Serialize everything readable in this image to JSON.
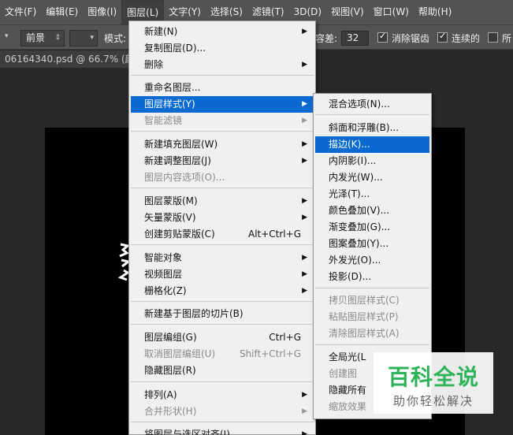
{
  "menubar": {
    "items": [
      "文件(F)",
      "编辑(E)",
      "图像(I)",
      "图层(L)",
      "文字(Y)",
      "选择(S)",
      "滤镜(T)",
      "3D(D)",
      "视图(V)",
      "窗口(W)",
      "帮助(H)"
    ]
  },
  "options": {
    "fill_source": "前景",
    "mode_label": "模式:",
    "tolerance_label": "容差:",
    "tolerance_value": "32",
    "antialias_label": "消除锯齿",
    "contiguous_label": "连续的",
    "all_layers_label": "所"
  },
  "document": {
    "tab_title": "06164340.psd @ 66.7% (颜色"
  },
  "layer_menu": {
    "items": [
      {
        "label": "新建(N)",
        "shortcut": "",
        "submenu": true,
        "disabled": false
      },
      {
        "label": "复制图层(D)...",
        "shortcut": "",
        "submenu": false,
        "disabled": false
      },
      {
        "label": "删除",
        "shortcut": "",
        "submenu": true,
        "disabled": false
      },
      {
        "label": "重命名图层...",
        "shortcut": "",
        "submenu": false,
        "disabled": false
      },
      {
        "label": "图层样式(Y)",
        "shortcut": "",
        "submenu": true,
        "disabled": false
      },
      {
        "label": "智能滤镜",
        "shortcut": "",
        "submenu": true,
        "disabled": true
      },
      {
        "label": "新建填充图层(W)",
        "shortcut": "",
        "submenu": true,
        "disabled": false
      },
      {
        "label": "新建调整图层(J)",
        "shortcut": "",
        "submenu": true,
        "disabled": false
      },
      {
        "label": "图层内容选项(O)...",
        "shortcut": "",
        "submenu": false,
        "disabled": true
      },
      {
        "label": "图层蒙版(M)",
        "shortcut": "",
        "submenu": true,
        "disabled": false
      },
      {
        "label": "矢量蒙版(V)",
        "shortcut": "",
        "submenu": true,
        "disabled": false
      },
      {
        "label": "创建剪贴蒙版(C)",
        "shortcut": "Alt+Ctrl+G",
        "submenu": false,
        "disabled": false
      },
      {
        "label": "智能对象",
        "shortcut": "",
        "submenu": true,
        "disabled": false
      },
      {
        "label": "视频图层",
        "shortcut": "",
        "submenu": true,
        "disabled": false
      },
      {
        "label": "栅格化(Z)",
        "shortcut": "",
        "submenu": true,
        "disabled": false
      },
      {
        "label": "新建基于图层的切片(B)",
        "shortcut": "",
        "submenu": false,
        "disabled": false
      },
      {
        "label": "图层编组(G)",
        "shortcut": "Ctrl+G",
        "submenu": false,
        "disabled": false
      },
      {
        "label": "取消图层编组(U)",
        "shortcut": "Shift+Ctrl+G",
        "submenu": false,
        "disabled": true
      },
      {
        "label": "隐藏图层(R)",
        "shortcut": "",
        "submenu": false,
        "disabled": false
      },
      {
        "label": "排列(A)",
        "shortcut": "",
        "submenu": true,
        "disabled": false
      },
      {
        "label": "合并形状(H)",
        "shortcut": "",
        "submenu": true,
        "disabled": true
      },
      {
        "label": "将图层与选区对齐(I)",
        "shortcut": "",
        "submenu": true,
        "disabled": false
      }
    ]
  },
  "style_submenu": {
    "items": [
      {
        "label": "混合选项(N)...",
        "disabled": false
      },
      {
        "label": "斜面和浮雕(B)...",
        "disabled": false
      },
      {
        "label": "描边(K)...",
        "disabled": false
      },
      {
        "label": "内阴影(I)...",
        "disabled": false
      },
      {
        "label": "内发光(W)...",
        "disabled": false
      },
      {
        "label": "光泽(T)...",
        "disabled": false
      },
      {
        "label": "颜色叠加(V)...",
        "disabled": false
      },
      {
        "label": "渐变叠加(G)...",
        "disabled": false
      },
      {
        "label": "图案叠加(Y)...",
        "disabled": false
      },
      {
        "label": "外发光(O)...",
        "disabled": false
      },
      {
        "label": "投影(D)...",
        "disabled": false
      },
      {
        "label": "拷贝图层样式(C)",
        "disabled": true
      },
      {
        "label": "粘贴图层样式(P)",
        "disabled": true
      },
      {
        "label": "清除图层样式(A)",
        "disabled": true
      },
      {
        "label": "全局光(L",
        "disabled": false
      },
      {
        "label": "创建图",
        "disabled": true
      },
      {
        "label": "隐藏所有",
        "disabled": false
      },
      {
        "label": "缩放效果",
        "disabled": true
      }
    ]
  },
  "watermark": {
    "title": "百科全说",
    "subtitle": "助你轻松解决"
  },
  "colors": {
    "highlight": "#0a6ad0",
    "watermark_green": "#2fb35a"
  }
}
